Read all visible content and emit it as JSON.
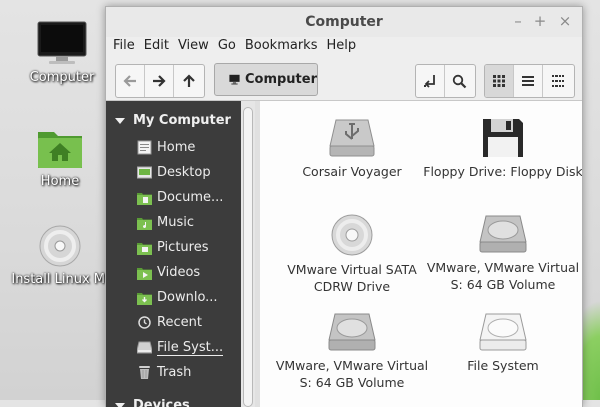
{
  "desktop": {
    "icons": [
      {
        "label": "Computer",
        "icon": "monitor-icon"
      },
      {
        "label": "Home",
        "icon": "home-folder-icon"
      },
      {
        "label": "Install Linux Mi",
        "icon": "disc-icon"
      }
    ]
  },
  "window": {
    "title": "Computer",
    "controls": [
      "minimize",
      "maximize",
      "close"
    ],
    "menu": [
      "File",
      "Edit",
      "View",
      "Go",
      "Bookmarks",
      "Help"
    ],
    "toolbar": {
      "location_label": "Computer",
      "nav_buttons": [
        "back-icon",
        "forward-icon",
        "up-icon"
      ],
      "view_buttons": [
        "icon-view",
        "list-view",
        "compact-view"
      ],
      "active_view": "icon-view"
    }
  },
  "sidebar": {
    "section_title": "My Computer",
    "items": [
      {
        "label": "Home",
        "icon": "home-icon"
      },
      {
        "label": "Desktop",
        "icon": "desktop-icon"
      },
      {
        "label": "Docume...",
        "icon": "documents-folder-icon"
      },
      {
        "label": "Music",
        "icon": "music-folder-icon"
      },
      {
        "label": "Pictures",
        "icon": "pictures-folder-icon"
      },
      {
        "label": "Videos",
        "icon": "videos-folder-icon"
      },
      {
        "label": "Downlo...",
        "icon": "downloads-folder-icon"
      },
      {
        "label": "Recent",
        "icon": "recent-icon"
      },
      {
        "label": "File Syst...",
        "icon": "drive-icon"
      },
      {
        "label": "Trash",
        "icon": "trash-icon"
      }
    ],
    "next_section_title": "Devices"
  },
  "content": {
    "items": [
      {
        "label": "Corsair Voyager",
        "icon": "usb-drive-icon"
      },
      {
        "label": "Floppy Drive: Floppy Disk",
        "icon": "floppy-icon"
      },
      {
        "label": "VMware Virtual SATA CDRW Drive",
        "icon": "cd-icon"
      },
      {
        "label": "VMware, VMware Virtual S: 64 GB Volume",
        "icon": "hard-drive-icon"
      },
      {
        "label": "VMware, VMware Virtual S: 64 GB Volume",
        "icon": "hard-drive-icon"
      },
      {
        "label": "File System",
        "icon": "filesystem-drive-icon"
      }
    ]
  },
  "colors": {
    "sidebar_bg": "#3c3c3c",
    "content_bg": "#fdfdfd",
    "folder_green": "#6eb544"
  }
}
